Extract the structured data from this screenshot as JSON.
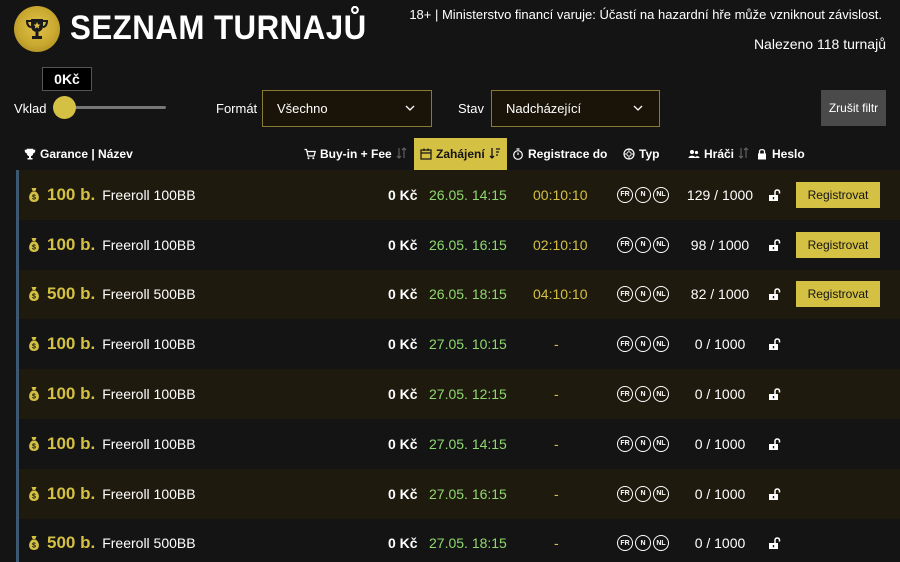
{
  "header": {
    "title": "SEZNAM TURNAJŮ",
    "disclaimer": "18+ | Ministerstvo financí varuje: Účastí na hazardní hře může vzniknout závislost.",
    "found": "Nalezeno 118 turnajů",
    "logo_icon": "trophy-icon"
  },
  "filters": {
    "stake_value": "0Kč",
    "stake_label": "Vklad",
    "stake_level": 0,
    "format_label": "Formát",
    "format_value": "Všechno",
    "state_label": "Stav",
    "state_value": "Nadcházející",
    "reset_label": "Zrušit filtr"
  },
  "columns": {
    "name": "Garance | Název",
    "buyin": "Buy-in + Fee",
    "start": "Zahájení",
    "registration": "Registrace do",
    "type": "Typ",
    "players": "Hráči",
    "password": "Heslo"
  },
  "badges": [
    "FR",
    "N",
    "NL"
  ],
  "register_label": "Registrovat",
  "colors": {
    "accent": "#d4c043",
    "start_time": "#8fd86e",
    "row_odd": "#1f1a0e",
    "row_even": "#141414",
    "row_marker": "#3d5872"
  },
  "tournaments": [
    {
      "guarantee": "100 b.",
      "name": "Freeroll 100BB",
      "buyin": "0 Kč",
      "start": "26.05. 14:15",
      "registration": "00:10:10",
      "players": "129 / 1000",
      "can_register": true
    },
    {
      "guarantee": "100 b.",
      "name": "Freeroll 100BB",
      "buyin": "0 Kč",
      "start": "26.05. 16:15",
      "registration": "02:10:10",
      "players": "98 / 1000",
      "can_register": true
    },
    {
      "guarantee": "500 b.",
      "name": "Freeroll 500BB",
      "buyin": "0 Kč",
      "start": "26.05. 18:15",
      "registration": "04:10:10",
      "players": "82 / 1000",
      "can_register": true
    },
    {
      "guarantee": "100 b.",
      "name": "Freeroll 100BB",
      "buyin": "0 Kč",
      "start": "27.05. 10:15",
      "registration": "-",
      "players": "0 / 1000",
      "can_register": false
    },
    {
      "guarantee": "100 b.",
      "name": "Freeroll 100BB",
      "buyin": "0 Kč",
      "start": "27.05. 12:15",
      "registration": "-",
      "players": "0 / 1000",
      "can_register": false
    },
    {
      "guarantee": "100 b.",
      "name": "Freeroll 100BB",
      "buyin": "0 Kč",
      "start": "27.05. 14:15",
      "registration": "-",
      "players": "0 / 1000",
      "can_register": false
    },
    {
      "guarantee": "100 b.",
      "name": "Freeroll 100BB",
      "buyin": "0 Kč",
      "start": "27.05. 16:15",
      "registration": "-",
      "players": "0 / 1000",
      "can_register": false
    },
    {
      "guarantee": "500 b.",
      "name": "Freeroll 500BB",
      "buyin": "0 Kč",
      "start": "27.05. 18:15",
      "registration": "-",
      "players": "0 / 1000",
      "can_register": false
    }
  ]
}
